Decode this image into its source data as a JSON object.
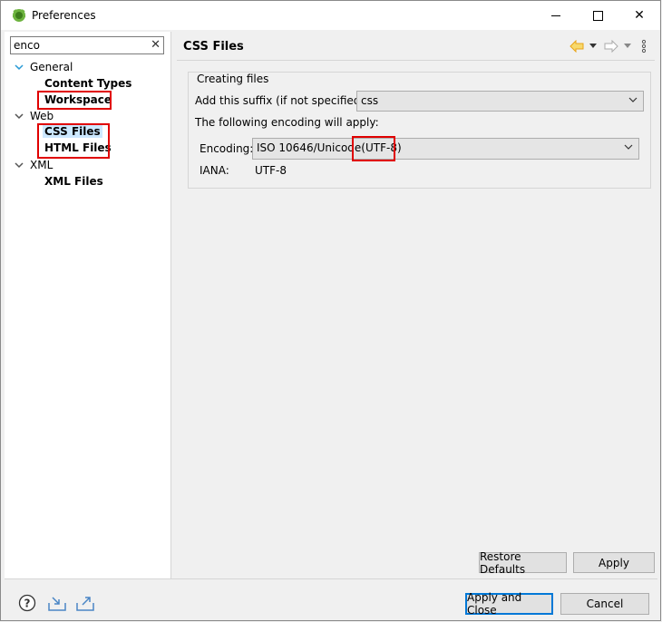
{
  "window": {
    "title": "Preferences",
    "minimize_symbol": "—",
    "close_symbol": "✕"
  },
  "filter": {
    "value": "enco",
    "clear_symbol": "✕"
  },
  "tree": {
    "general": {
      "label": "General",
      "children": [
        "Content Types",
        "Workspace"
      ]
    },
    "web": {
      "label": "Web",
      "children": [
        "CSS Files",
        "HTML Files"
      ]
    },
    "xml": {
      "label": "XML",
      "children": [
        "XML Files"
      ]
    }
  },
  "page": {
    "title": "CSS Files",
    "group_label": "Creating files",
    "suffix_label": "Add this suffix (if not specified):",
    "suffix_value": "css",
    "encoding_note": "The following encoding will apply:",
    "encoding_label": "Encoding:",
    "encoding_value": "ISO 10646/Unicode(UTF-8)",
    "iana_label": "IANA:",
    "iana_value": "UTF-8"
  },
  "buttons": {
    "restore_defaults": "Restore Defaults",
    "apply": "Apply",
    "apply_and_close": "Apply and Close",
    "cancel": "Cancel"
  },
  "colors": {
    "highlight_box": "#e00000",
    "selection": "#cce8ff",
    "default_button_border": "#0078d7",
    "nav_back_arrow": "#e8a317"
  },
  "icons": {
    "app": "eclipse-icon",
    "back": "back-arrow-icon",
    "forward": "forward-arrow-icon",
    "menu": "view-menu-icon",
    "help": "help-icon",
    "import": "import-icon",
    "export": "export-icon"
  }
}
